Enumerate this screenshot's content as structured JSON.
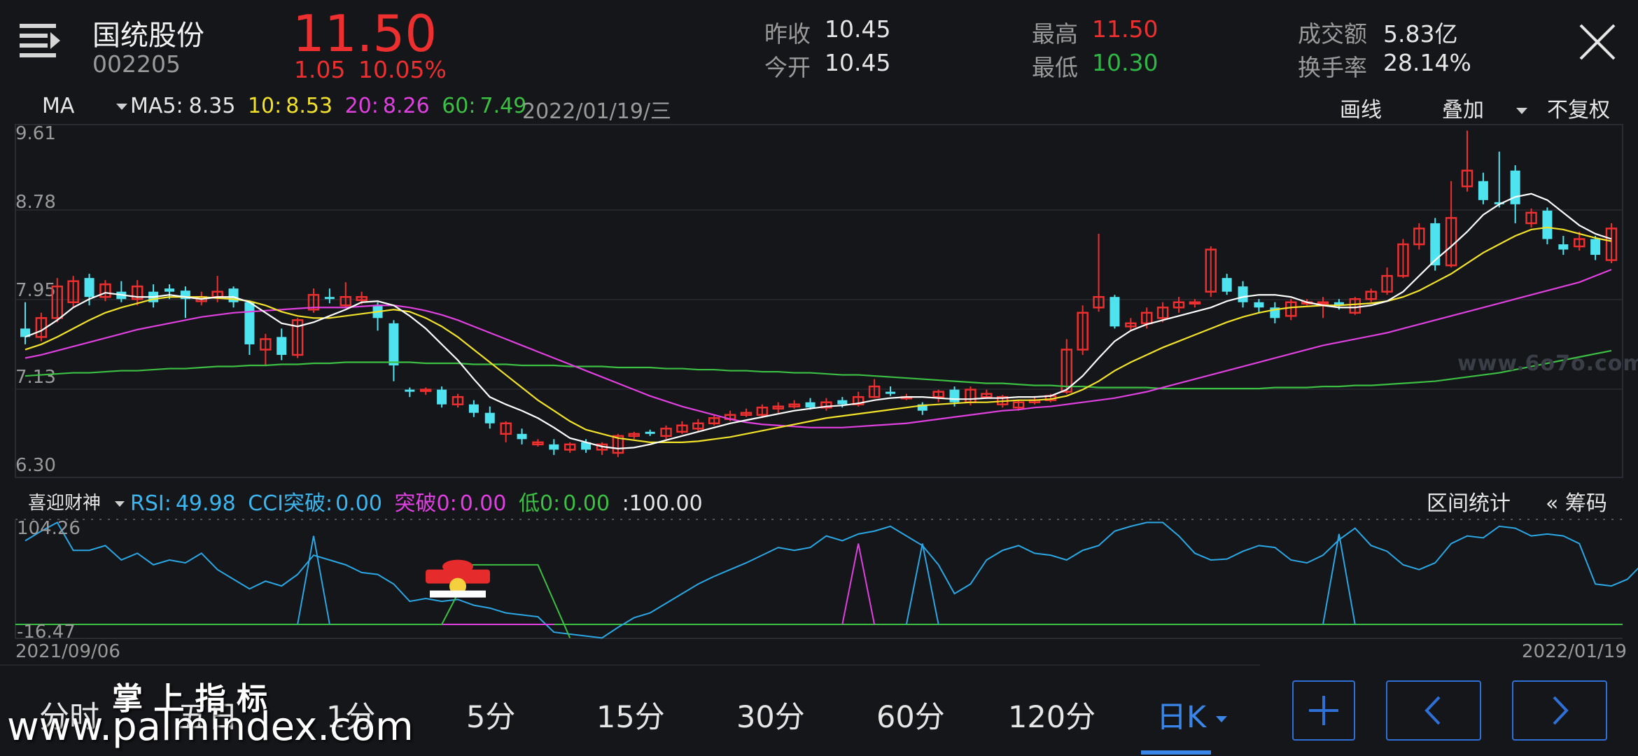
{
  "header": {
    "stock_name": "国统股份",
    "stock_code": "002205",
    "price": "11.50",
    "change": "1.05",
    "change_pct": "10.05%",
    "stats": {
      "prev_close_label": "昨收",
      "prev_close": "10.45",
      "open_label": "今开",
      "open": "10.45",
      "high_label": "最高",
      "high": "11.50",
      "low_label": "最低",
      "low": "10.30",
      "amount_label": "成交额",
      "amount": "5.83亿",
      "turnover_label": "换手率",
      "turnover": "28.14%"
    }
  },
  "ma_bar": {
    "indicator": "MA",
    "ma5_label": "MA5:",
    "ma5": "8.35",
    "ma10_label": "10:",
    "ma10": "8.53",
    "ma20_label": "20:",
    "ma20": "8.26",
    "ma60_label": "60:",
    "ma60": "7.49",
    "date": "2022/01/19/三",
    "draw_label": "画线",
    "overlay_label": "叠加",
    "adjust_label": "不复权"
  },
  "price_axis": [
    "9.61",
    "8.78",
    "7.95",
    "7.13",
    "6.30"
  ],
  "watermark": "www.6o7o.com",
  "indicator_bar": {
    "name": "喜迎财神",
    "rsi_label": "RSI:",
    "rsi": "49.98",
    "cci_label": "CCI突破:",
    "cci": "0.00",
    "break_label": "突破0:",
    "break": "0.00",
    "low_label": "低0:",
    "low": "0.00",
    "extra": ":100.00",
    "range_label": "区间统计",
    "chips_label": "筹码"
  },
  "indicator_axis": [
    "104.26",
    "-16.47"
  ],
  "dates": {
    "start": "2021/09/06",
    "end": "2022/01/19"
  },
  "tabs": [
    "分时",
    "五日",
    "1分",
    "5分",
    "15分",
    "30分",
    "60分",
    "120分",
    "日K"
  ],
  "active_tab": "日K",
  "overlay_text": {
    "title": "掌 上 指 标",
    "url": "www.palmindex.com"
  },
  "colors": {
    "up": "#ee2f2f",
    "down": "#4fe3f0",
    "ma5": "#ffffff",
    "ma10": "#f2e22a",
    "ma20": "#e040e0",
    "ma60": "#3cc043",
    "accent": "#2e6fd8"
  },
  "chart_data": {
    "type": "candlestick",
    "ylim": [
      6.3,
      9.61
    ],
    "candles": [
      [
        7.7,
        7.62,
        7.95,
        7.55
      ],
      [
        7.62,
        7.8,
        7.85,
        7.58
      ],
      [
        7.8,
        8.1,
        8.18,
        7.76
      ],
      [
        7.95,
        8.15,
        8.2,
        7.9
      ],
      [
        8.18,
        8.0,
        8.22,
        7.92
      ],
      [
        8.0,
        8.12,
        8.16,
        7.96
      ],
      [
        8.05,
        7.98,
        8.15,
        7.95
      ],
      [
        7.98,
        8.1,
        8.16,
        7.92
      ],
      [
        8.05,
        7.95,
        8.12,
        7.9
      ],
      [
        8.08,
        8.05,
        8.12,
        7.98
      ],
      [
        8.06,
        7.98,
        8.1,
        7.8
      ],
      [
        7.96,
        8.0,
        8.05,
        7.92
      ],
      [
        8.0,
        8.05,
        8.2,
        7.95
      ],
      [
        8.08,
        7.95,
        8.1,
        7.9
      ],
      [
        7.95,
        7.55,
        7.96,
        7.45
      ],
      [
        7.5,
        7.6,
        7.65,
        7.35
      ],
      [
        7.62,
        7.45,
        7.7,
        7.4
      ],
      [
        7.45,
        7.78,
        7.8,
        7.42
      ],
      [
        7.88,
        8.02,
        8.08,
        7.85
      ],
      [
        8.0,
        7.98,
        8.08,
        7.94
      ],
      [
        7.92,
        8.0,
        8.14,
        7.9
      ],
      [
        7.97,
        8.0,
        8.05,
        7.93
      ],
      [
        7.92,
        7.8,
        7.95,
        7.68
      ],
      [
        7.75,
        7.35,
        7.78,
        7.2
      ],
      [
        7.12,
        7.1,
        7.14,
        7.05
      ],
      [
        7.12,
        7.12,
        7.14,
        7.07
      ],
      [
        7.12,
        6.98,
        7.15,
        6.95
      ],
      [
        6.98,
        7.05,
        7.08,
        6.95
      ],
      [
        6.98,
        6.9,
        7.02,
        6.86
      ],
      [
        6.9,
        6.8,
        6.96,
        6.75
      ],
      [
        6.7,
        6.8,
        6.82,
        6.62
      ],
      [
        6.7,
        6.65,
        6.75,
        6.6
      ],
      [
        6.6,
        6.62,
        6.65,
        6.58
      ],
      [
        6.6,
        6.55,
        6.65,
        6.5
      ],
      [
        6.55,
        6.6,
        6.62,
        6.52
      ],
      [
        6.62,
        6.55,
        6.65,
        6.52
      ],
      [
        6.55,
        6.6,
        6.62,
        6.5
      ],
      [
        6.52,
        6.68,
        6.7,
        6.48
      ],
      [
        6.68,
        6.7,
        6.72,
        6.65
      ],
      [
        6.72,
        6.7,
        6.74,
        6.68
      ],
      [
        6.68,
        6.75,
        6.78,
        6.65
      ],
      [
        6.72,
        6.78,
        6.82,
        6.7
      ],
      [
        6.75,
        6.8,
        6.84,
        6.72
      ],
      [
        6.8,
        6.85,
        6.88,
        6.78
      ],
      [
        6.84,
        6.88,
        6.92,
        6.82
      ],
      [
        6.88,
        6.9,
        6.94,
        6.86
      ],
      [
        6.88,
        6.95,
        6.98,
        6.85
      ],
      [
        6.94,
        6.96,
        7.0,
        6.9
      ],
      [
        6.96,
        6.98,
        7.02,
        6.94
      ],
      [
        7.0,
        6.95,
        7.04,
        6.93
      ],
      [
        6.95,
        7.0,
        7.04,
        6.92
      ],
      [
        7.02,
        6.98,
        7.05,
        6.95
      ],
      [
        6.98,
        7.05,
        7.1,
        6.96
      ],
      [
        7.05,
        7.15,
        7.22,
        7.04
      ],
      [
        7.1,
        7.08,
        7.15,
        7.06
      ],
      [
        7.05,
        7.05,
        7.08,
        7.02
      ],
      [
        6.98,
        6.92,
        7.0,
        6.88
      ],
      [
        7.05,
        7.1,
        7.12,
        7.0
      ],
      [
        7.12,
        7.0,
        7.15,
        6.96
      ],
      [
        7.0,
        7.12,
        7.15,
        6.97
      ],
      [
        7.05,
        7.08,
        7.12,
        7.03
      ],
      [
        6.98,
        7.05,
        7.07,
        6.95
      ],
      [
        6.95,
        7.0,
        7.02,
        6.92
      ],
      [
        7.0,
        7.02,
        7.06,
        6.98
      ],
      [
        7.02,
        7.06,
        7.08,
        7.0
      ],
      [
        7.1,
        7.5,
        7.6,
        7.08
      ],
      [
        7.5,
        7.85,
        7.92,
        7.45
      ],
      [
        7.9,
        8.0,
        8.6,
        7.86
      ],
      [
        8.0,
        7.72,
        8.02,
        7.7
      ],
      [
        7.72,
        7.75,
        7.8,
        7.68
      ],
      [
        7.75,
        7.85,
        7.9,
        7.7
      ],
      [
        7.8,
        7.9,
        7.95,
        7.76
      ],
      [
        7.9,
        7.95,
        8.0,
        7.85
      ],
      [
        7.95,
        7.95,
        7.98,
        7.9
      ],
      [
        8.05,
        8.45,
        8.48,
        8.0
      ],
      [
        8.18,
        8.05,
        8.22,
        8.02
      ],
      [
        8.1,
        7.95,
        8.15,
        7.9
      ],
      [
        7.95,
        7.9,
        7.98,
        7.85
      ],
      [
        7.9,
        7.8,
        7.95,
        7.75
      ],
      [
        7.82,
        7.95,
        7.98,
        7.78
      ],
      [
        7.95,
        7.95,
        7.98,
        7.92
      ],
      [
        7.95,
        7.95,
        8.0,
        7.8
      ],
      [
        7.95,
        7.92,
        7.98,
        7.88
      ],
      [
        7.85,
        7.98,
        8.0,
        7.83
      ],
      [
        7.98,
        8.05,
        8.08,
        7.95
      ],
      [
        8.05,
        8.2,
        8.28,
        8.02
      ],
      [
        8.2,
        8.5,
        8.55,
        8.18
      ],
      [
        8.5,
        8.65,
        8.7,
        8.45
      ],
      [
        8.7,
        8.3,
        8.75,
        8.25
      ],
      [
        8.3,
        8.75,
        9.1,
        8.28
      ],
      [
        9.05,
        9.2,
        9.58,
        9.0
      ],
      [
        9.1,
        8.92,
        9.18,
        8.88
      ],
      [
        8.9,
        8.88,
        9.38,
        8.85
      ],
      [
        9.2,
        8.88,
        9.25,
        8.7
      ],
      [
        8.7,
        8.8,
        8.84,
        8.66
      ],
      [
        8.82,
        8.55,
        8.85,
        8.5
      ],
      [
        8.5,
        8.45,
        8.58,
        8.4
      ],
      [
        8.48,
        8.55,
        8.62,
        8.44
      ],
      [
        8.55,
        8.4,
        8.58,
        8.35
      ],
      [
        8.35,
        8.65,
        8.7,
        8.32
      ]
    ],
    "ma5": [
      7.62,
      7.68,
      7.78,
      7.9,
      7.98,
      8.04,
      8.02,
      8.0,
      8.0,
      8.02,
      8.0,
      7.98,
      8.0,
      8.0,
      7.95,
      7.85,
      7.75,
      7.72,
      7.76,
      7.82,
      7.88,
      7.95,
      7.96,
      7.92,
      7.82,
      7.7,
      7.55,
      7.4,
      7.22,
      7.05,
      6.98,
      6.92,
      6.85,
      6.76,
      6.66,
      6.62,
      6.58,
      6.56,
      6.57,
      6.6,
      6.64,
      6.68,
      6.72,
      6.76,
      6.8,
      6.83,
      6.86,
      6.89,
      6.92,
      6.94,
      6.96,
      6.97,
      6.99,
      7.02,
      7.04,
      7.05,
      7.05,
      7.04,
      7.03,
      7.03,
      7.04,
      7.04,
      7.05,
      7.05,
      7.06,
      7.12,
      7.25,
      7.42,
      7.58,
      7.68,
      7.74,
      7.78,
      7.82,
      7.86,
      7.9,
      7.96,
      8.0,
      8.02,
      8.02,
      8.0,
      7.95,
      7.92,
      7.9,
      7.9,
      7.92,
      7.96,
      8.05,
      8.2,
      8.35,
      8.48,
      8.62,
      8.78,
      8.88,
      8.95,
      8.98,
      8.92,
      8.8,
      8.68,
      8.6,
      8.55
    ],
    "ma10": [
      7.5,
      7.55,
      7.62,
      7.7,
      7.78,
      7.85,
      7.9,
      7.94,
      7.98,
      8.0,
      8.0,
      8.0,
      7.99,
      7.98,
      7.96,
      7.92,
      7.86,
      7.82,
      7.8,
      7.8,
      7.82,
      7.84,
      7.86,
      7.88,
      7.86,
      7.8,
      7.72,
      7.62,
      7.5,
      7.38,
      7.26,
      7.14,
      7.02,
      6.92,
      6.82,
      6.74,
      6.7,
      6.66,
      6.64,
      6.62,
      6.62,
      6.62,
      6.63,
      6.65,
      6.67,
      6.7,
      6.73,
      6.76,
      6.79,
      6.82,
      6.85,
      6.87,
      6.89,
      6.91,
      6.93,
      6.95,
      6.97,
      6.98,
      6.99,
      7.0,
      7.0,
      7.01,
      7.02,
      7.02,
      7.03,
      7.06,
      7.12,
      7.2,
      7.3,
      7.38,
      7.45,
      7.52,
      7.58,
      7.64,
      7.7,
      7.76,
      7.81,
      7.85,
      7.88,
      7.9,
      7.91,
      7.92,
      7.92,
      7.93,
      7.94,
      7.96,
      8.0,
      8.06,
      8.14,
      8.22,
      8.32,
      8.42,
      8.5,
      8.58,
      8.64,
      8.66,
      8.64,
      8.6,
      8.56,
      8.53
    ],
    "ma20": [
      7.42,
      7.45,
      7.49,
      7.53,
      7.57,
      7.61,
      7.65,
      7.69,
      7.72,
      7.75,
      7.78,
      7.81,
      7.83,
      7.85,
      7.86,
      7.87,
      7.88,
      7.89,
      7.9,
      7.9,
      7.9,
      7.91,
      7.92,
      7.92,
      7.9,
      7.87,
      7.83,
      7.78,
      7.72,
      7.66,
      7.6,
      7.54,
      7.48,
      7.42,
      7.36,
      7.3,
      7.24,
      7.18,
      7.12,
      7.06,
      7.01,
      6.96,
      6.92,
      6.88,
      6.84,
      6.81,
      6.79,
      6.78,
      6.77,
      6.76,
      6.76,
      6.76,
      6.77,
      6.78,
      6.79,
      6.8,
      6.82,
      6.84,
      6.86,
      6.88,
      6.9,
      6.92,
      6.93,
      6.95,
      6.96,
      6.98,
      7.0,
      7.02,
      7.04,
      7.07,
      7.1,
      7.14,
      7.18,
      7.22,
      7.26,
      7.3,
      7.34,
      7.38,
      7.42,
      7.46,
      7.5,
      7.54,
      7.57,
      7.6,
      7.63,
      7.66,
      7.7,
      7.74,
      7.78,
      7.82,
      7.86,
      7.9,
      7.94,
      7.98,
      8.02,
      8.06,
      8.1,
      8.14,
      8.2,
      8.26
    ],
    "ma60": [
      7.25,
      7.26,
      7.27,
      7.28,
      7.28,
      7.29,
      7.3,
      7.3,
      7.31,
      7.32,
      7.32,
      7.33,
      7.34,
      7.34,
      7.35,
      7.35,
      7.36,
      7.36,
      7.37,
      7.37,
      7.38,
      7.38,
      7.38,
      7.38,
      7.38,
      7.37,
      7.37,
      7.37,
      7.36,
      7.36,
      7.36,
      7.35,
      7.35,
      7.35,
      7.34,
      7.34,
      7.34,
      7.33,
      7.33,
      7.33,
      7.32,
      7.32,
      7.31,
      7.31,
      7.3,
      7.3,
      7.29,
      7.29,
      7.28,
      7.28,
      7.27,
      7.26,
      7.26,
      7.25,
      7.24,
      7.23,
      7.22,
      7.21,
      7.2,
      7.19,
      7.18,
      7.18,
      7.17,
      7.16,
      7.16,
      7.15,
      7.15,
      7.14,
      7.14,
      7.14,
      7.14,
      7.13,
      7.13,
      7.13,
      7.13,
      7.13,
      7.13,
      7.13,
      7.14,
      7.14,
      7.14,
      7.15,
      7.15,
      7.16,
      7.16,
      7.17,
      7.18,
      7.19,
      7.2,
      7.22,
      7.24,
      7.26,
      7.28,
      7.31,
      7.34,
      7.37,
      7.4,
      7.43,
      7.46,
      7.49
    ],
    "indicator": {
      "ylim": [
        -16.47,
        104.26
      ],
      "rsi": [
        85,
        95,
        104,
        75,
        75,
        80,
        65,
        72,
        60,
        65,
        62,
        72,
        55,
        45,
        35,
        43,
        38,
        50,
        70,
        65,
        60,
        52,
        50,
        40,
        22,
        25,
        22,
        24,
        18,
        15,
        10,
        8,
        6,
        -10,
        -12,
        -14,
        -16,
        -5,
        5,
        10,
        20,
        30,
        40,
        48,
        55,
        62,
        70,
        78,
        75,
        78,
        90,
        85,
        92,
        95,
        100,
        90,
        80,
        60,
        30,
        40,
        65,
        75,
        80,
        72,
        70,
        65,
        75,
        80,
        95,
        100,
        104,
        104,
        90,
        72,
        65,
        66,
        74,
        80,
        78,
        65,
        62,
        70,
        86,
        98,
        80,
        74,
        60,
        55,
        62,
        82,
        90,
        88,
        100,
        98,
        90,
        92,
        90,
        82,
        40,
        38,
        45,
        62
      ],
      "cci_spikes": [
        [
          18,
          90
        ],
        [
          56,
          82
        ],
        [
          82,
          92
        ]
      ],
      "break_spike": 52,
      "low_step": [
        [
          27,
          30
        ],
        [
          27,
          60
        ],
        [
          32,
          60
        ],
        [
          34,
          -16
        ]
      ]
    }
  }
}
